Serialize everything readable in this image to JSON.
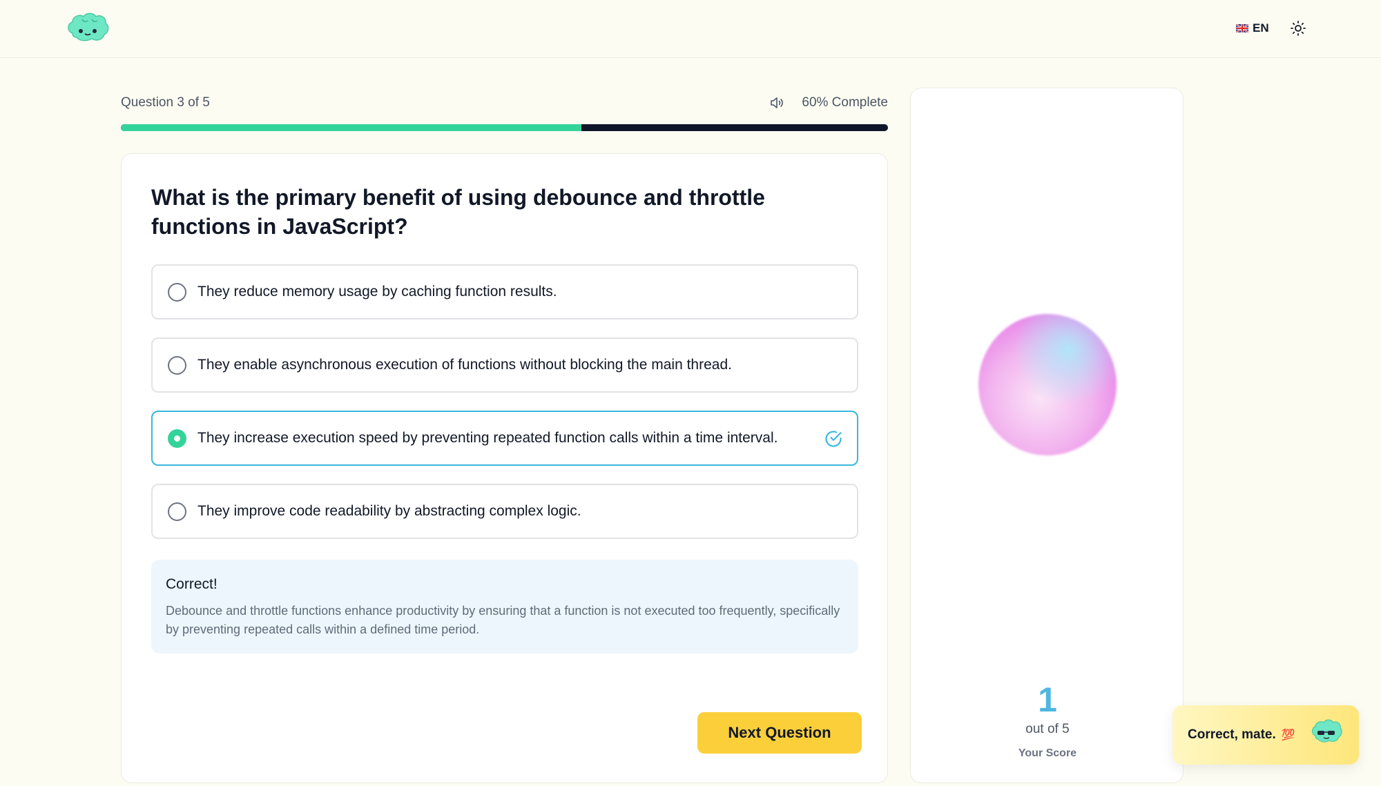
{
  "header": {
    "language": "EN",
    "flag_icon": "uk-flag-icon",
    "theme_icon": "sun-icon"
  },
  "progress": {
    "question_label": "Question 3 of 5",
    "complete_label": "60% Complete",
    "fraction": 0.6
  },
  "quiz": {
    "question": "What is the primary benefit of using debounce and throttle functions in JavaScript?",
    "options": [
      {
        "label": "They reduce memory usage by caching function results.",
        "selected": false
      },
      {
        "label": "They enable asynchronous execution of functions without blocking the main thread.",
        "selected": false
      },
      {
        "label": "They increase execution speed by preventing repeated function calls within a time interval.",
        "selected": true
      },
      {
        "label": "They improve code readability by abstracting complex logic.",
        "selected": false
      }
    ],
    "feedback": {
      "title": "Correct!",
      "text": "Debounce and throttle functions enhance productivity by ensuring that a function is not executed too frequently, specifically by preventing repeated calls within a defined time period."
    },
    "next_label": "Next Question"
  },
  "score": {
    "value": "1",
    "out_of": "out of 5",
    "label": "Your Score"
  },
  "toast": {
    "text": "Correct, mate.",
    "emoji": "💯"
  },
  "colors": {
    "accent_green": "#34d399",
    "accent_blue": "#38b6dd",
    "button_yellow": "#fbcf3a",
    "background": "#fdfcf3"
  }
}
